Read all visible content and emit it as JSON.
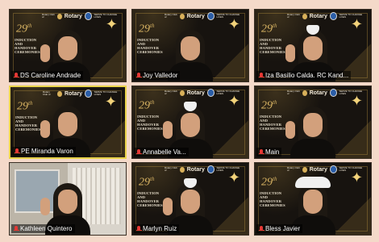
{
  "meeting": {
    "banner": {
      "number": "29",
      "suffix": "th",
      "title": "INDUCTION AND HANDOVER CEREMONIES",
      "club_small": "Rotary Club of",
      "rotary": "Rotary",
      "tagline": "SERVE TO CHANGE LIVES"
    },
    "participants": [
      {
        "name": "DS Caroline Andrade",
        "muted": true
      },
      {
        "name": "Joy Valledor",
        "muted": true
      },
      {
        "name": "Iza Basilio Calda. RC Kand...",
        "muted": true
      },
      {
        "name": "PE Miranda Varon",
        "muted": true,
        "active": true
      },
      {
        "name": "Annabelle Va...",
        "muted": true
      },
      {
        "name": "Main",
        "muted": true
      },
      {
        "name": "Kathleen Quintero",
        "muted": true
      },
      {
        "name": "Marlyn Ruiz",
        "muted": true
      },
      {
        "name": "Bless Javier",
        "muted": true
      }
    ]
  }
}
